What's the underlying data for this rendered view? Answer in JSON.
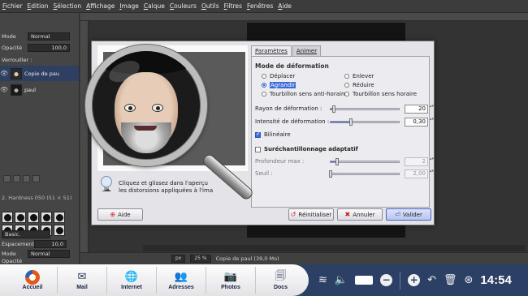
{
  "menu": [
    "Fichier",
    "Edition",
    "Sélection",
    "Affichage",
    "Image",
    "Calque",
    "Couleurs",
    "Outils",
    "Filtres",
    "Fenêtres",
    "Aide"
  ],
  "left_dock": {
    "mode_label": "Mode",
    "mode_value": "Normal",
    "opacity_label": "Opacité",
    "opacity_value": "100,0",
    "lock_label": "Verrouiller :",
    "layers": [
      {
        "name": "Copie de pau",
        "selected": true
      },
      {
        "name": "paul",
        "selected": false
      }
    ],
    "brush_set": "2. Hardness 050 (51 × 51)",
    "brush_preset": "Basic.",
    "spacing_label": "Espacement",
    "spacing_value": "10,0",
    "tool_mode_label": "Mode",
    "tool_mode_value": "Normal",
    "tool_opacity_label": "Opacité"
  },
  "canvas": {
    "unit": "px",
    "zoom": "25 %",
    "status": "Copie de paul (39,0 Mo)"
  },
  "dialog": {
    "tabs": [
      {
        "label": "Paramètres",
        "active": true
      },
      {
        "label": "Animer",
        "active": false
      }
    ],
    "hint": "Cliquez et glissez dans l'aperçu\nles distorsions appliquées à l'ima",
    "section_mode": "Mode de déformation",
    "modes_left": [
      {
        "label": "Déplacer",
        "selected": false
      },
      {
        "label": "Agrandir",
        "selected": true
      },
      {
        "label": "Tourbillon sens anti-horaire",
        "selected": false
      }
    ],
    "modes_right": [
      {
        "label": "Enlever",
        "selected": false
      },
      {
        "label": "Réduire",
        "selected": false
      },
      {
        "label": "Tourbillon sens horaire",
        "selected": false
      }
    ],
    "radius": {
      "label": "Rayon de déformation :",
      "value": "20",
      "level": 0.05
    },
    "intensity": {
      "label": "Intensité de déformation :",
      "value": "0,30",
      "level": 0.3
    },
    "bilinear": {
      "label": "Bilinéaire",
      "checked": true
    },
    "supersampling": {
      "label": "Suréchantillonnage adaptatif",
      "checked": false
    },
    "max_depth": {
      "label": "Profondeur max :",
      "value": "2",
      "level": 0.1
    },
    "threshold": {
      "label": "Seuil :",
      "value": "2,00",
      "level": 0.0
    },
    "buttons": {
      "help": "Aide",
      "reset": "Réinitialiser",
      "cancel": "Annuler",
      "ok": "Valider"
    }
  },
  "taskbar": {
    "items": [
      {
        "label": "Accueil",
        "icon": "home-logo-icon"
      },
      {
        "label": "Mail",
        "icon": "mail-icon"
      },
      {
        "label": "Internet",
        "icon": "globe-icon"
      },
      {
        "label": "Adresses",
        "icon": "contacts-icon"
      },
      {
        "label": "Photos",
        "icon": "camera-icon"
      },
      {
        "label": "Docs",
        "icon": "documents-icon"
      }
    ],
    "clock": "14:54"
  },
  "colors": {
    "accent": "#3b6bd8",
    "taskbar_bg": "#2c3f64",
    "dialog_bg": "#e3e3e8"
  }
}
